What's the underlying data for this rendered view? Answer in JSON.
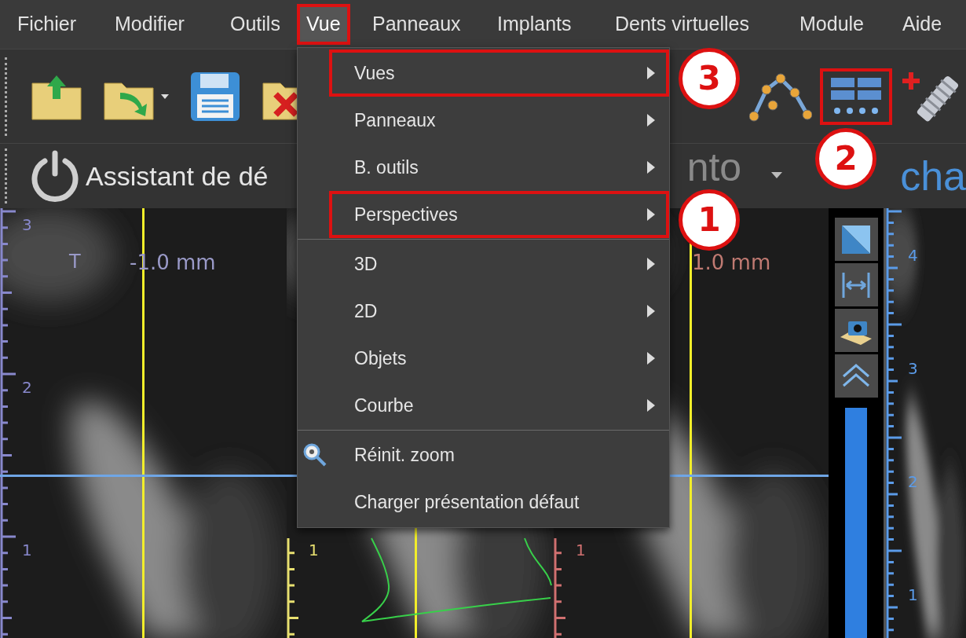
{
  "menubar": {
    "items": [
      {
        "label": "Fichier",
        "selected": false,
        "outlined": false
      },
      {
        "label": "Modifier",
        "selected": false,
        "outlined": false
      },
      {
        "label": "Outils",
        "selected": false,
        "outlined": false
      },
      {
        "label": "Vue",
        "selected": true,
        "outlined": true
      },
      {
        "label": "Panneaux",
        "selected": false,
        "outlined": false
      },
      {
        "label": "Implants",
        "selected": false,
        "outlined": false
      },
      {
        "label": "Dents virtuelles",
        "selected": false,
        "outlined": false
      },
      {
        "label": "Module",
        "selected": false,
        "outlined": false
      },
      {
        "label": "Aide",
        "selected": false,
        "outlined": false
      }
    ]
  },
  "dropdown": {
    "items": [
      {
        "kind": "submenu",
        "label": "Vues",
        "outlined": true,
        "callout": "3"
      },
      {
        "kind": "submenu",
        "label": "Panneaux",
        "outlined": false
      },
      {
        "kind": "submenu",
        "label": "B. outils",
        "outlined": false
      },
      {
        "kind": "submenu",
        "label": "Perspectives",
        "outlined": true,
        "callout": "1"
      },
      {
        "kind": "separator"
      },
      {
        "kind": "submenu",
        "label": "3D",
        "outlined": false
      },
      {
        "kind": "submenu",
        "label": "2D",
        "outlined": false
      },
      {
        "kind": "submenu",
        "label": "Objets",
        "outlined": false
      },
      {
        "kind": "submenu",
        "label": "Courbe",
        "outlined": false
      },
      {
        "kind": "separator"
      },
      {
        "kind": "zoom",
        "label": "Réinit. zoom",
        "outlined": false
      },
      {
        "kind": "command",
        "label": "Charger présentation défaut",
        "outlined": false
      }
    ]
  },
  "toolbar": {
    "left_tools": [
      {
        "kind": "folder-up",
        "outlined": false
      },
      {
        "kind": "folder-forward",
        "outlined": false
      },
      {
        "kind": "floppy",
        "outlined": false
      },
      {
        "kind": "folder-delete",
        "outlined": false
      }
    ],
    "right_tools": [
      {
        "kind": "curve-nodes",
        "outlined": false
      },
      {
        "kind": "layout",
        "outlined": true,
        "callout": "2"
      },
      {
        "kind": "implant-add",
        "outlined": false
      }
    ]
  },
  "workflow_bar": {
    "wizard_label": "Assistant de dé",
    "selector_value": "nto",
    "link_text": "cha"
  },
  "viewer": {
    "panes": [
      {
        "ruler_labels": [
          "3",
          "2",
          "1"
        ],
        "label": "T",
        "offset": "-1.0 mm",
        "curve": false
      },
      {
        "ruler_labels": [
          "1"
        ],
        "curve": true
      },
      {
        "ruler_labels": [
          "1"
        ],
        "offset": "1.0 mm",
        "curve": false
      }
    ],
    "side_buttons": [
      {
        "kind": "triangle"
      },
      {
        "kind": "width"
      },
      {
        "kind": "camera"
      },
      {
        "kind": "chevrons"
      }
    ],
    "slider": {
      "level": 1
    },
    "depth_ruler": {
      "labels": [
        "4",
        "3",
        "2",
        "1"
      ]
    }
  }
}
